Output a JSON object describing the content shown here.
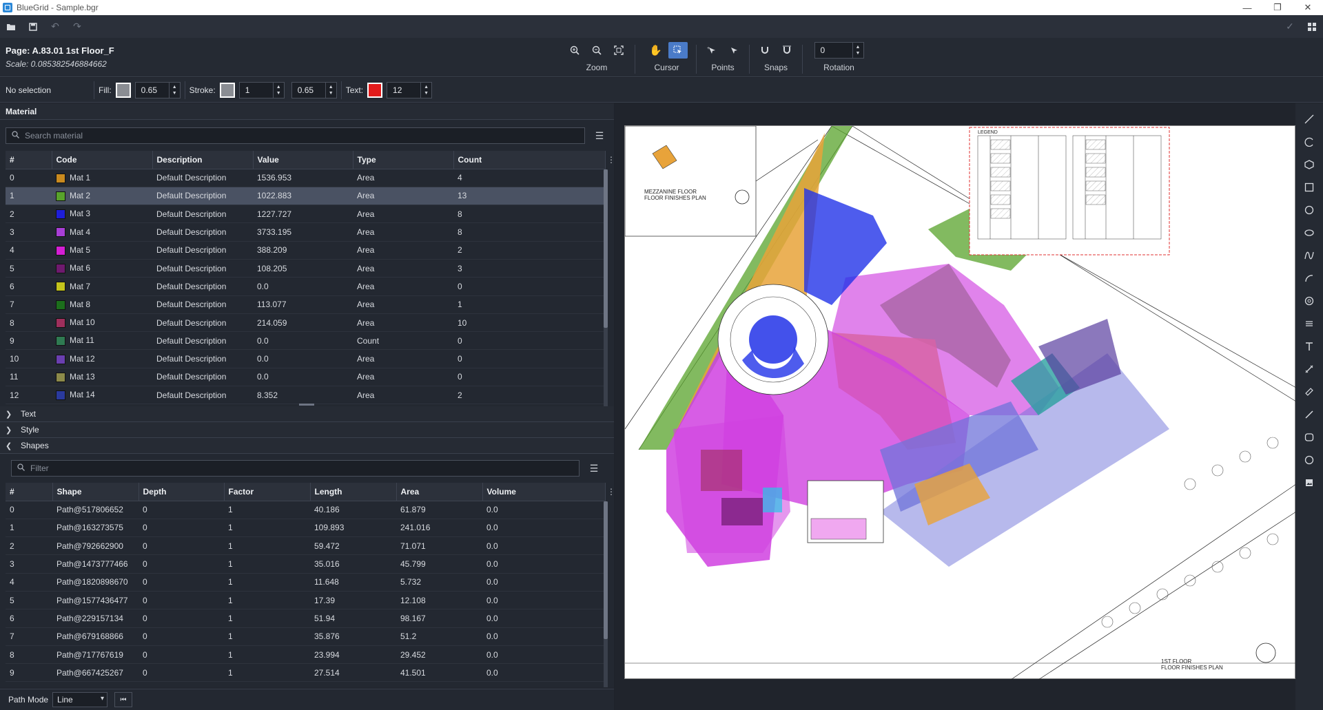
{
  "window": {
    "title": "BlueGrid - Sample.bgr"
  },
  "page": {
    "title": "Page: A.83.01 1st Floor_F",
    "scale": "Scale: 0.085382546884662"
  },
  "toolbar_groups": {
    "zoom": "Zoom",
    "cursor": "Cursor",
    "points": "Points",
    "snaps": "Snaps",
    "rotation": "Rotation",
    "rotation_value": "0"
  },
  "props": {
    "selection": "No selection",
    "fill_label": "Fill:",
    "fill_opacity": "0.65",
    "stroke_label": "Stroke:",
    "stroke_width": "1",
    "stroke_opacity": "0.65",
    "text_label": "Text:",
    "text_size": "12",
    "text_color": "#e21b1b"
  },
  "material": {
    "header": "Material",
    "search_placeholder": "Search material",
    "columns": [
      "#",
      "Code",
      "Description",
      "Value",
      "Type",
      "Count"
    ],
    "rows": [
      {
        "idx": "0",
        "color": "#c98a1f",
        "code": "Mat 1",
        "desc": "Default Description",
        "value": "1536.953",
        "type": "Area",
        "count": "4"
      },
      {
        "idx": "1",
        "color": "#58a32b",
        "code": "Mat 2",
        "desc": "Default Description",
        "value": "1022.883",
        "type": "Area",
        "count": "13"
      },
      {
        "idx": "2",
        "color": "#1e1ed8",
        "code": "Mat 3",
        "desc": "Default Description",
        "value": "1227.727",
        "type": "Area",
        "count": "8"
      },
      {
        "idx": "3",
        "color": "#a83fd6",
        "code": "Mat 4",
        "desc": "Default Description",
        "value": "3733.195",
        "type": "Area",
        "count": "8"
      },
      {
        "idx": "4",
        "color": "#d41fd4",
        "code": "Mat 5",
        "desc": "Default Description",
        "value": "388.209",
        "type": "Area",
        "count": "2"
      },
      {
        "idx": "5",
        "color": "#6e1a6e",
        "code": "Mat 6",
        "desc": "Default Description",
        "value": "108.205",
        "type": "Area",
        "count": "3"
      },
      {
        "idx": "6",
        "color": "#c4c41c",
        "code": "Mat 7",
        "desc": "Default Description",
        "value": "0.0",
        "type": "Area",
        "count": "0"
      },
      {
        "idx": "7",
        "color": "#1c6e1c",
        "code": "Mat 8",
        "desc": "Default Description",
        "value": "113.077",
        "type": "Area",
        "count": "1"
      },
      {
        "idx": "8",
        "color": "#9e2f5c",
        "code": "Mat 10",
        "desc": "Default Description",
        "value": "214.059",
        "type": "Area",
        "count": "10"
      },
      {
        "idx": "9",
        "color": "#2f7a52",
        "code": "Mat 11",
        "desc": "Default Description",
        "value": "0.0",
        "type": "Count",
        "count": "0"
      },
      {
        "idx": "10",
        "color": "#6a3fb0",
        "code": "Mat 12",
        "desc": "Default Description",
        "value": "0.0",
        "type": "Area",
        "count": "0"
      },
      {
        "idx": "11",
        "color": "#8c8a4a",
        "code": "Mat 13",
        "desc": "Default Description",
        "value": "0.0",
        "type": "Area",
        "count": "0"
      },
      {
        "idx": "12",
        "color": "#2a3a9e",
        "code": "Mat 14",
        "desc": "Default Description",
        "value": "8.352",
        "type": "Area",
        "count": "2"
      }
    ]
  },
  "sections": {
    "text": "Text",
    "style": "Style",
    "shapes": "Shapes"
  },
  "shapes": {
    "filter_placeholder": "Filter",
    "columns": [
      "#",
      "Shape",
      "Depth",
      "Factor",
      "Length",
      "Area",
      "Volume"
    ],
    "rows": [
      {
        "idx": "0",
        "shape": "Path@517806652",
        "depth": "0",
        "factor": "1",
        "length": "40.186",
        "area": "61.879",
        "volume": "0.0"
      },
      {
        "idx": "1",
        "shape": "Path@163273575",
        "depth": "0",
        "factor": "1",
        "length": "109.893",
        "area": "241.016",
        "volume": "0.0"
      },
      {
        "idx": "2",
        "shape": "Path@792662900",
        "depth": "0",
        "factor": "1",
        "length": "59.472",
        "area": "71.071",
        "volume": "0.0"
      },
      {
        "idx": "3",
        "shape": "Path@1473777466",
        "depth": "0",
        "factor": "1",
        "length": "35.016",
        "area": "45.799",
        "volume": "0.0"
      },
      {
        "idx": "4",
        "shape": "Path@1820898670",
        "depth": "0",
        "factor": "1",
        "length": "11.648",
        "area": "5.732",
        "volume": "0.0"
      },
      {
        "idx": "5",
        "shape": "Path@1577436477",
        "depth": "0",
        "factor": "1",
        "length": "17.39",
        "area": "12.108",
        "volume": "0.0"
      },
      {
        "idx": "6",
        "shape": "Path@229157134",
        "depth": "0",
        "factor": "1",
        "length": "51.94",
        "area": "98.167",
        "volume": "0.0"
      },
      {
        "idx": "7",
        "shape": "Path@679168866",
        "depth": "0",
        "factor": "1",
        "length": "35.876",
        "area": "51.2",
        "volume": "0.0"
      },
      {
        "idx": "8",
        "shape": "Path@717767619",
        "depth": "0",
        "factor": "1",
        "length": "23.994",
        "area": "29.452",
        "volume": "0.0"
      },
      {
        "idx": "9",
        "shape": "Path@667425267",
        "depth": "0",
        "factor": "1",
        "length": "27.514",
        "area": "41.501",
        "volume": "0.0"
      }
    ]
  },
  "bottom": {
    "path_mode_label": "Path Mode",
    "path_mode_value": "Line"
  },
  "drawing": {
    "legend": "LEGEND",
    "mezz_title_1": "MEZZANINE FLOOR",
    "mezz_title_2": "FLOOR FINISHES PLAN",
    "floor_title_1": "1ST FLOOR",
    "floor_title_2": "FLOOR FINISHES PLAN"
  },
  "icons": {
    "app": "bluegrid-logo-icon",
    "toolbar": [
      "open-folder-icon",
      "save-icon",
      "undo-icon",
      "redo-icon"
    ],
    "tools": [
      "zoom-in-icon",
      "zoom-out-icon",
      "zoom-fit-icon",
      "pan-hand-icon",
      "select-cursor-icon",
      "add-point-icon",
      "remove-point-icon",
      "snap-icon",
      "snap-off-icon"
    ],
    "right_tools": [
      "line-icon",
      "arc-icon",
      "hexagon-icon",
      "rectangle-icon",
      "circle-icon",
      "ellipse-icon",
      "curve-icon",
      "arc2-icon",
      "spiral-icon",
      "multiline-icon",
      "text-icon",
      "measure-icon",
      "ruler-icon",
      "pencil-icon",
      "rounded-rect-icon",
      "ring-icon",
      "image-icon"
    ]
  }
}
